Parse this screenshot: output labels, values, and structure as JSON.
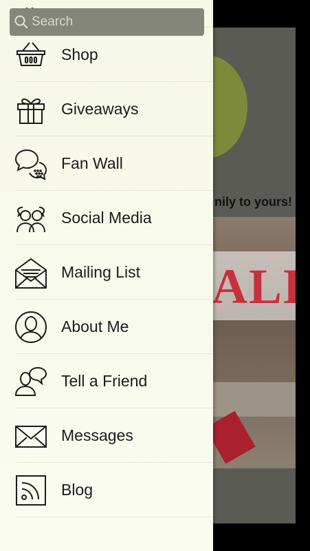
{
  "search": {
    "placeholder": "Search"
  },
  "menu": {
    "items": [
      {
        "label": "",
        "icon": "partial-icon"
      },
      {
        "label": "Shop",
        "icon": "basket-icon"
      },
      {
        "label": "Giveaways",
        "icon": "gift-icon"
      },
      {
        "label": "Fan Wall",
        "icon": "chat-bubbles-icon"
      },
      {
        "label": "Social Media",
        "icon": "people-icon"
      },
      {
        "label": "Mailing List",
        "icon": "open-envelope-icon"
      },
      {
        "label": "About Me",
        "icon": "user-circle-icon"
      },
      {
        "label": "Tell a Friend",
        "icon": "friend-chat-icon"
      },
      {
        "label": "Messages",
        "icon": "envelope-icon"
      },
      {
        "label": "Blog",
        "icon": "rss-icon"
      }
    ]
  },
  "background": {
    "tagline": "nily to yours!",
    "sale_text": "ALE"
  },
  "colors": {
    "drawer_bg": "#f8f9ec",
    "search_bg": "#85867a",
    "text": "#1b1b1b"
  }
}
